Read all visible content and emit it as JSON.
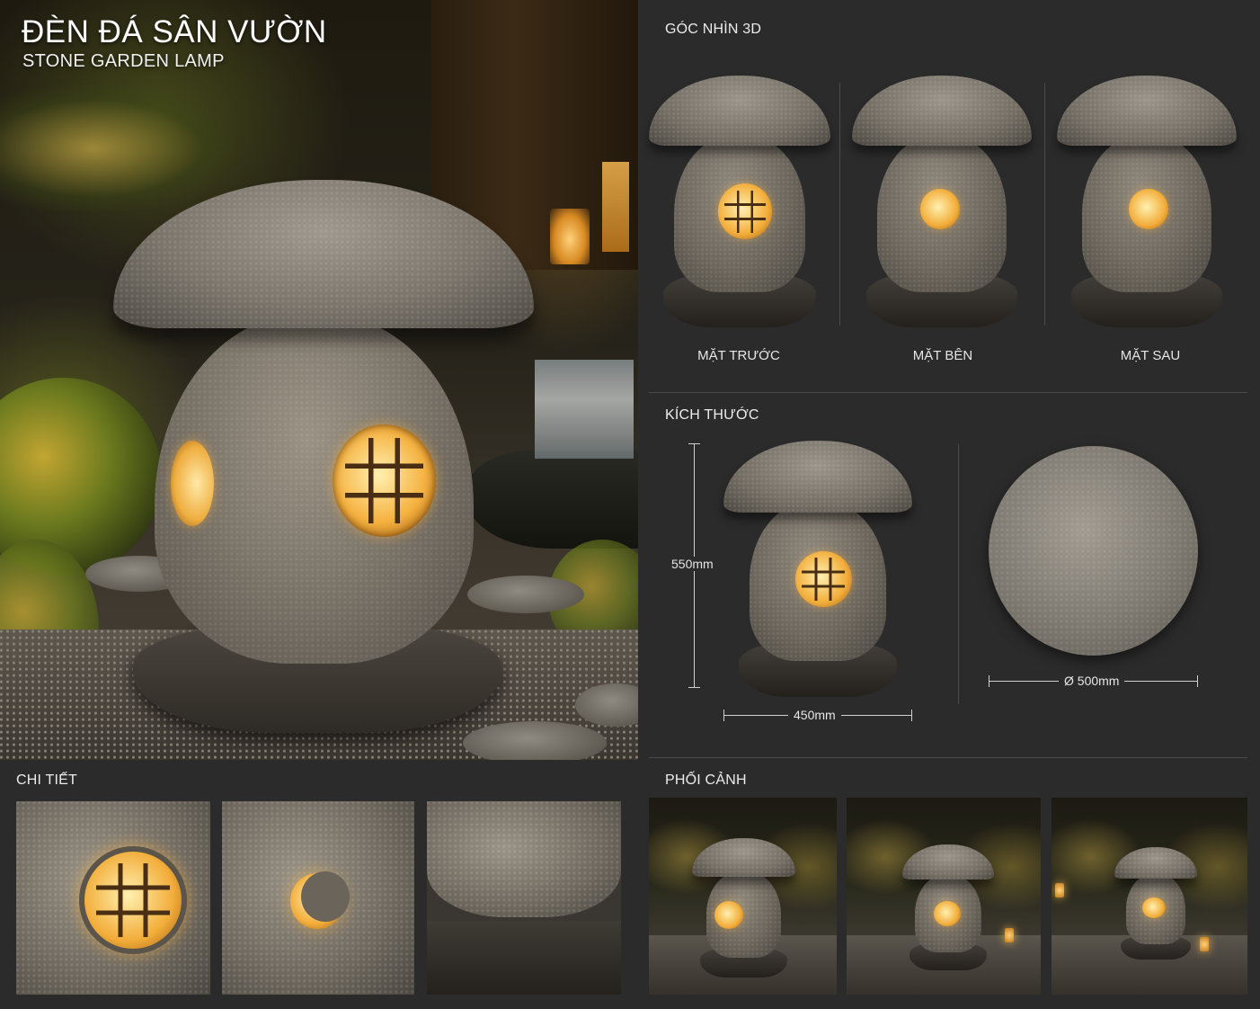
{
  "header": {
    "title": "ĐÈN ĐÁ SÂN VƯỜN",
    "subtitle": "STONE GARDEN LAMP"
  },
  "sections": {
    "views_3d": "GÓC NHÌN 3D",
    "dimensions": "KÍCH THƯỚC",
    "details": "CHI TIẾT",
    "scenes": "PHỐI CẢNH"
  },
  "views": [
    {
      "label": "MẶT TRƯỚC"
    },
    {
      "label": "MẶT BÊN"
    },
    {
      "label": "MẶT SAU"
    }
  ],
  "dimensions": {
    "height": "550mm",
    "width": "450mm",
    "diameter": "Ø 500mm"
  },
  "icons": {
    "lamp": "stone-lamp-illustration"
  },
  "colors": {
    "background": "#2b2b2b",
    "lamp_glow": "#f2ad3a"
  }
}
